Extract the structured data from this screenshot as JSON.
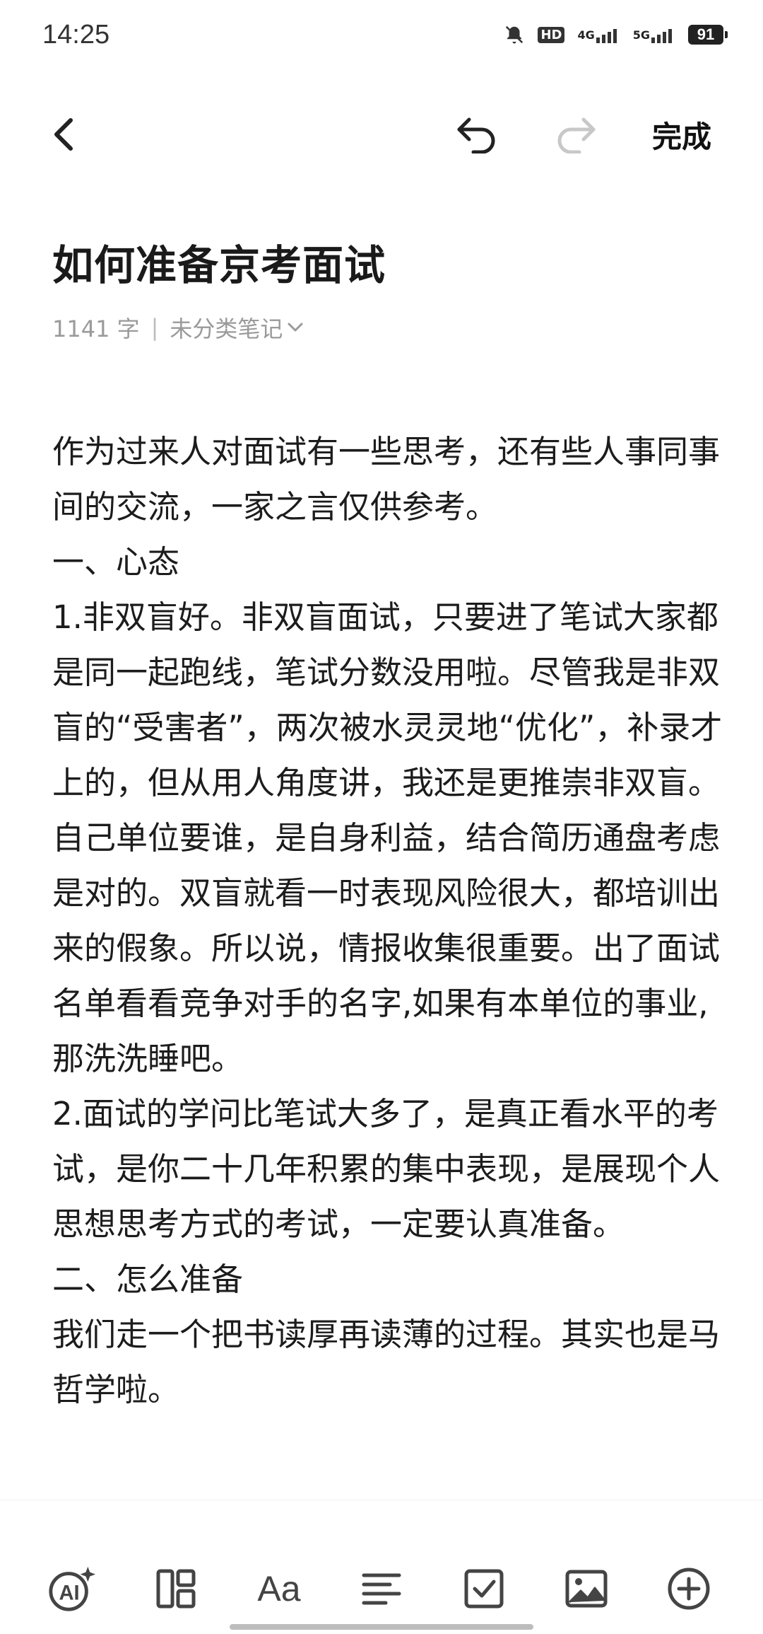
{
  "status_bar": {
    "time": "14:25",
    "hd_label": "HD",
    "signal_1": "4G",
    "signal_2": "5G",
    "battery": "91"
  },
  "toolbar": {
    "done_label": "完成"
  },
  "note": {
    "title": "如何准备京考面试",
    "word_count": "1141 字",
    "separator": "|",
    "folder": "未分类笔记",
    "paragraphs": [
      "作为过来人对面试有一些思考，还有些人事同事间的交流，一家之言仅供参考。",
      "一、心态",
      "1.非双盲好。非双盲面试，只要进了笔试大家都是同一起跑线，笔试分数没用啦。尽管我是非双盲的“受害者”，两次被水灵灵地“优化”，补录才上的，但从用人角度讲，我还是更推崇非双盲。自己单位要谁，是自身利益，结合简历通盘考虑是对的。双盲就看一时表现风险很大，都培训出来的假象。所以说，情报收集很重要。出了面试名单看看竞争对手的名字,如果有本单位的事业,那洗洗睡吧。",
      "2.面试的学问比笔试大多了，是真正看水平的考试，是你二十几年积累的集中表现，是展现个人思想思考方式的考试，一定要认真准备。",
      "二、怎么准备",
      "我们走一个把书读厚再读薄的过程。其实也是马哲学啦。"
    ]
  },
  "bottom_toolbar": {
    "font_label": "Aa",
    "icons": [
      "ai-icon",
      "layout-icon",
      "font-icon",
      "align-icon",
      "checkbox-icon",
      "image-icon",
      "add-icon"
    ]
  }
}
